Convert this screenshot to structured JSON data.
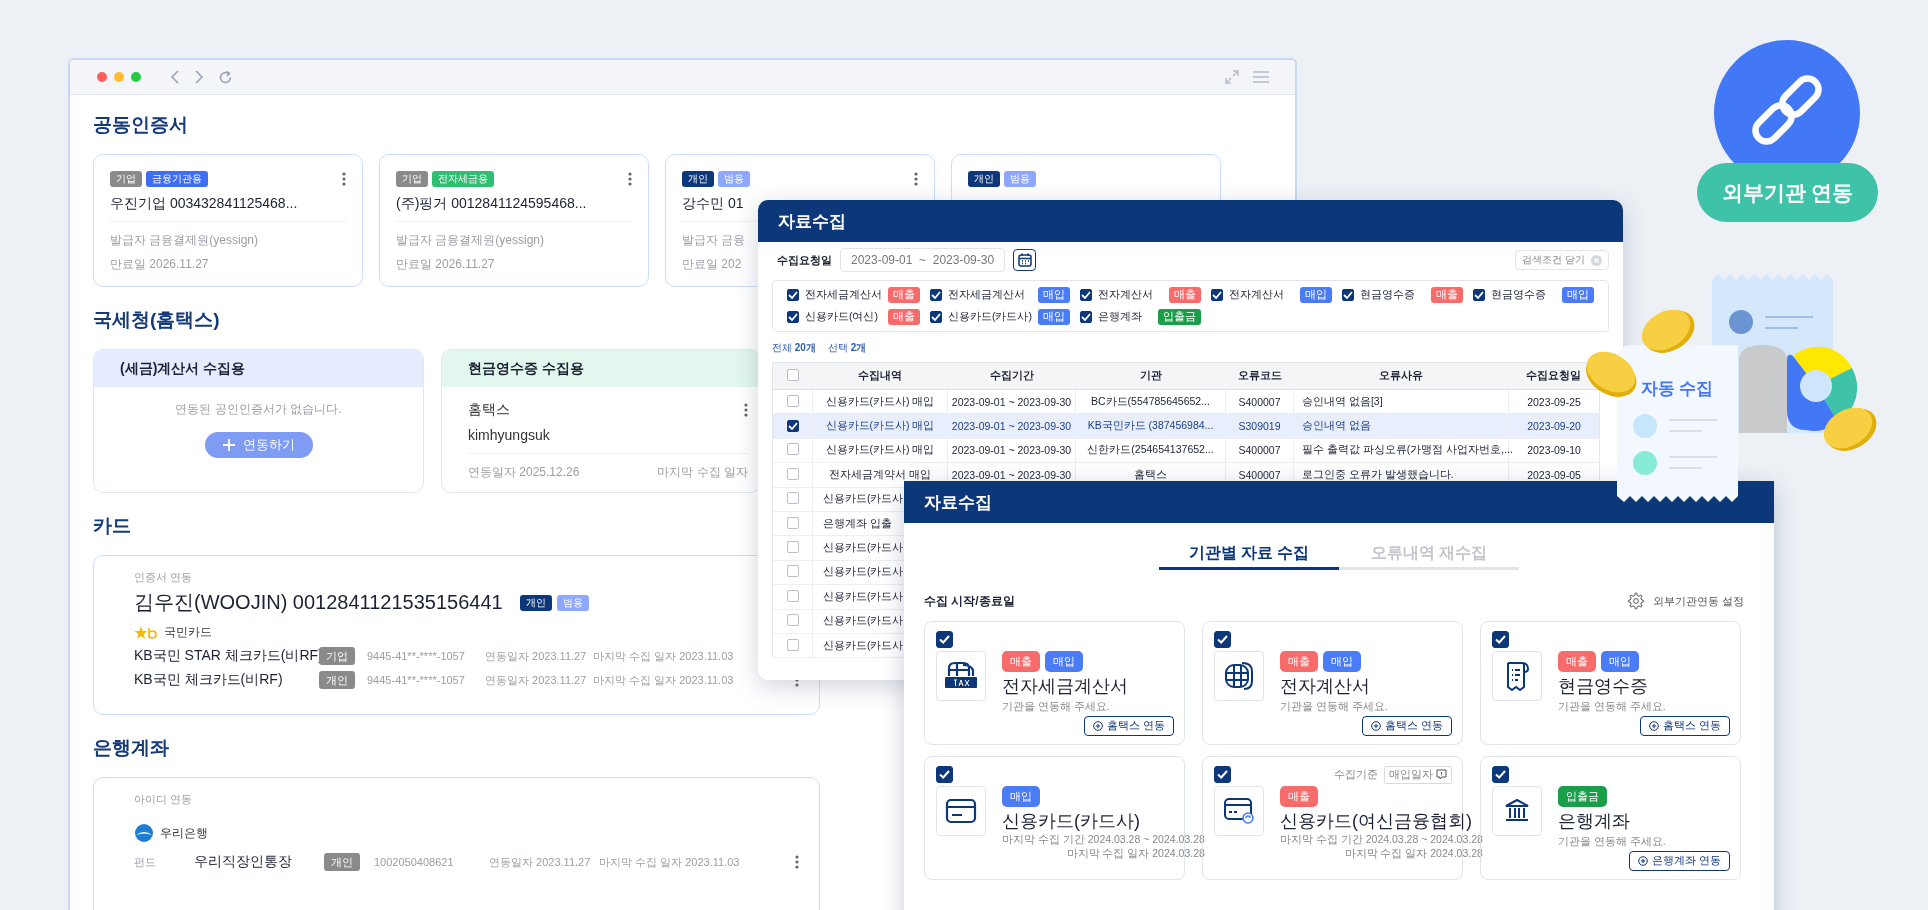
{
  "certificates": {
    "title": "공동인증서",
    "cards": [
      {
        "badges": [
          {
            "label": "기업",
            "color": "#8a8a8a"
          },
          {
            "label": "금융기관용",
            "color": "#3d6ef5"
          }
        ],
        "name": "우진기업 003432841125468...",
        "issuer": "발급자 금융결제원(yessign)",
        "expiry": "만료일 2026.11.27"
      },
      {
        "badges": [
          {
            "label": "기업",
            "color": "#8a8a8a"
          },
          {
            "label": "전자세금용",
            "color": "#2fbf71"
          }
        ],
        "name": "(주)핑거 0012841124595468...",
        "issuer": "발급자 금융결제원(yessign)",
        "expiry": "만료일 2026.11.27"
      },
      {
        "badges": [
          {
            "label": "개인",
            "color": "#0c3779"
          },
          {
            "label": "범용",
            "color": "#8fa8ff"
          }
        ],
        "name": "강수민 01",
        "issuer": "발급자 금융",
        "expiry": "만료일 202"
      },
      {
        "badges": [
          {
            "label": "개인",
            "color": "#0c3779"
          },
          {
            "label": "범용",
            "color": "#8fa8ff"
          }
        ]
      }
    ]
  },
  "nts": {
    "title": "국세청(홈택스)",
    "boxes": [
      {
        "kind": "empty",
        "header": "(세금)계산서 수집용",
        "color": "#e6ecff",
        "message": "연동된 공인인증서가 없습니다.",
        "button": "연동하기"
      },
      {
        "kind": "linked",
        "header": "현금영수증 수집용",
        "color": "#e2f7ee",
        "provider": "홈택스",
        "account": "kimhyungsuk",
        "linked": "연동일자 2025.12.26",
        "last": "마지막 수집 일자"
      }
    ]
  },
  "cards": {
    "title": "카드",
    "group_label": "인증서 연동",
    "holder": "김우진(WOOJIN) 0012841121535156441",
    "badges": [
      {
        "label": "개인",
        "color": "#0c3779"
      },
      {
        "label": "범용",
        "color": "#8fa8ff"
      }
    ],
    "issuer": "국민카드",
    "rows": [
      {
        "name": "KB국민 STAR 체크카드(비RF)",
        "badge": "기업",
        "number": "9445-41**-****-1057",
        "linked": "연동일자 2023.11.27",
        "last": "마지막 수집 일자 2023.11.03"
      },
      {
        "name": "KB국민 체크카드(비RF)",
        "badge": "개인",
        "number": "9445-41**-****-1057",
        "linked": "연동일자 2023.11.27",
        "last": "마지막 수집 일자 2023.11.03"
      }
    ]
  },
  "bank": {
    "title": "은행계좌",
    "group_label": "아이디 연동",
    "bank": "우리은행",
    "rows": [
      {
        "type": "펀드",
        "name": "우리직장인통장",
        "badge": "개인",
        "number": "1002050408621",
        "linked": "연동일자 2023.11.27",
        "last": "마지막 수집 일자 2023.11.03"
      }
    ]
  },
  "collection": {
    "title": "자료수집",
    "date_label": "수집요청일",
    "date_range": "2023-09-01  ~  2023-09-30",
    "close_filter": "검색조건 닫기",
    "filters": [
      {
        "label": "전자세금계산서",
        "checked": true,
        "tag": {
          "label": "매출",
          "color": "#f76b6b"
        }
      },
      {
        "label": "전자세금계산서",
        "checked": true,
        "tag": {
          "label": "매입",
          "color": "#4a7cf7"
        }
      },
      {
        "label": "전자계산서",
        "checked": true,
        "tag": {
          "label": "매출",
          "color": "#f76b6b"
        }
      },
      {
        "label": "전자계산서",
        "checked": true,
        "tag": {
          "label": "매입",
          "color": "#4a7cf7"
        }
      },
      {
        "label": "현금영수증",
        "checked": true,
        "tag": {
          "label": "매출",
          "color": "#f76b6b"
        }
      },
      {
        "label": "현금영수증",
        "checked": true,
        "tag": {
          "label": "매입",
          "color": "#4a7cf7"
        }
      },
      {
        "label": "신용카드(여신)",
        "checked": true,
        "tag": {
          "label": "매출",
          "color": "#f76b6b"
        }
      },
      {
        "label": "신용카드(카드사)",
        "checked": true,
        "tag": {
          "label": "매입",
          "color": "#4a7cf7"
        }
      },
      {
        "label": "은행계좌",
        "checked": true,
        "tag": {
          "label": "입출금",
          "color": "#1a9e4a"
        }
      }
    ],
    "total": "전체 **20개**",
    "selected_count": "선택 **2개**",
    "select_all": false,
    "columns": [
      "수집내역",
      "수집기간",
      "기관",
      "오류코드",
      "오류사유",
      "수집요청일"
    ],
    "rows": [
      {
        "selected": false,
        "cells": [
          "신용카드(카드사) 매입",
          "2023-09-01 ~ 2023-09-30",
          "BC카드(554785645652...",
          "S400007",
          "승인내역 없음[3]",
          "2023-09-25"
        ]
      },
      {
        "selected": true,
        "cells": [
          "신용카드(카드사) 매입",
          "2023-09-01 ~ 2023-09-30",
          "KB국민카드 (387456984...",
          "S309019",
          "승인내역 없음",
          "2023-09-20"
        ]
      },
      {
        "selected": false,
        "cells": [
          "신용카드(카드사) 매입",
          "2023-09-01 ~ 2023-09-30",
          "신한카드(254654137652...",
          "S400007",
          "필수 출력값 파싱오류(가맹점 사업자번호,...",
          "2023-09-10"
        ]
      },
      {
        "selected": false,
        "cells": [
          "전자세금계약서 매입",
          "2023-09-01 ~ 2023-09-30",
          "홈택스",
          "S400007",
          "로그인중 오류가 발생했습니다.",
          "2023-09-05"
        ]
      },
      {
        "selected": false,
        "cells": [
          "신용카드(카드사"
        ]
      },
      {
        "selected": false,
        "cells": [
          "은행계좌 입출"
        ]
      },
      {
        "selected": false,
        "cells": [
          "신용카드(카드사"
        ]
      },
      {
        "selected": false,
        "cells": [
          "신용카드(카드사"
        ]
      },
      {
        "selected": false,
        "cells": [
          "신용카드(카드사"
        ]
      },
      {
        "selected": false,
        "cells": [
          "신용카드(카드사"
        ]
      },
      {
        "selected": false,
        "cells": [
          "신용카드(카드사"
        ]
      }
    ]
  },
  "collection_setup": {
    "title": "자료수집",
    "tabs": [
      {
        "label": "기관별 자료 수집",
        "selected": true
      },
      {
        "label": "오류내역 재수집",
        "selected": false
      }
    ],
    "period_label": "수집 시작/종료일",
    "settings": "외부기관연동 설정",
    "sources": [
      {
        "kind": "tax-invoice",
        "checked": true,
        "tags": [
          {
            "label": "매출",
            "color": "#f76b6b"
          },
          {
            "label": "매입",
            "color": "#4a7cf7"
          }
        ],
        "title": "전자세금계산서",
        "desc": "기관을 연동해 주세요.",
        "button": "홈택스 연동"
      },
      {
        "kind": "e-invoice",
        "checked": true,
        "tags": [
          {
            "label": "매출",
            "color": "#f76b6b"
          },
          {
            "label": "매입",
            "color": "#4a7cf7"
          }
        ],
        "title": "전자계산서",
        "desc": "기관을 연동해 주세요.",
        "button": "홈택스 연동"
      },
      {
        "kind": "cash-receipt",
        "checked": true,
        "tags": [
          {
            "label": "매출",
            "color": "#f76b6b"
          },
          {
            "label": "매입",
            "color": "#4a7cf7"
          }
        ],
        "title": "현금영수증",
        "desc": "기관을 연동해 주세요.",
        "button": "홈택스 연동"
      },
      {
        "kind": "card",
        "checked": true,
        "tags": [
          {
            "label": "매입",
            "color": "#4a7cf7"
          }
        ],
        "title": "신용카드(카드사)",
        "meta": [
          "마지막 수집 기간 2024.03.28 ~ 2024.03.28",
          "마지막 수집 일자 2024.03.28"
        ]
      },
      {
        "kind": "card-association",
        "checked": true,
        "criteria_label": "수집기준",
        "criteria": "매입일자",
        "tags": [
          {
            "label": "매출",
            "color": "#f76b6b"
          }
        ],
        "title": "신용카드(여신금융협회)",
        "meta": [
          "마지막 수집 기간 2024.03.28 ~ 2024.03.28",
          "마지막 수집 일자 2024.03.28"
        ]
      },
      {
        "kind": "bank",
        "checked": true,
        "tags": [
          {
            "label": "입출금",
            "color": "#1a9e4a"
          }
        ],
        "title": "은행계좌",
        "desc": "기관을 연동해 주세요.",
        "button": "은행계좌 연동"
      }
    ]
  },
  "promo": {
    "link_badge": "외부기관 연동",
    "receipt_label": "자동 수집"
  }
}
